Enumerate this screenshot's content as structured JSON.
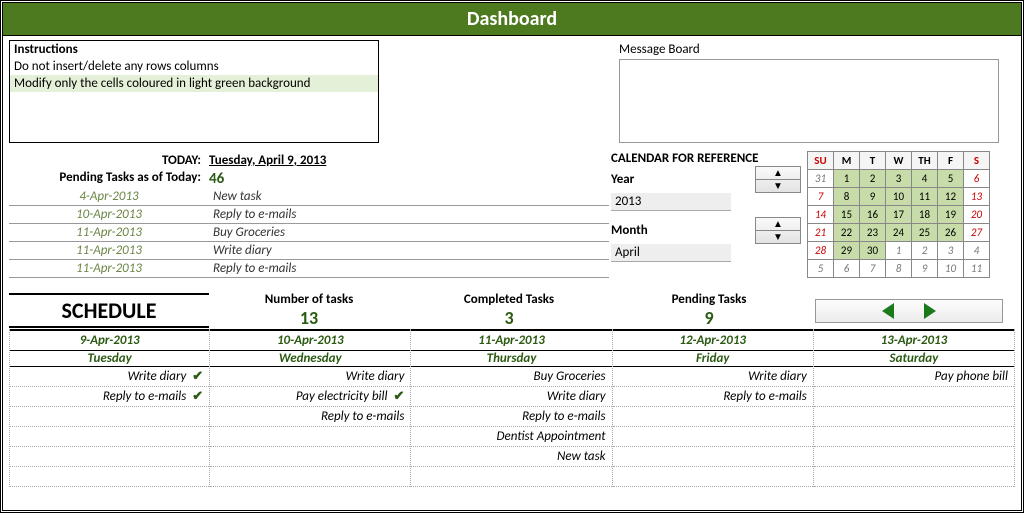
{
  "title": "Dashboard",
  "instructions": {
    "heading": "Instructions",
    "line1": "Do not insert/delete any rows columns",
    "line2": "Modify only the cells coloured in light green background"
  },
  "message_board_label": "Message Board",
  "today_label": "TODAY:",
  "today_value": "Tuesday, April 9, 2013",
  "pending_label": "Pending Tasks as of Today:",
  "pending_count": "46",
  "pending_list": [
    {
      "date": "4-Apr-2013",
      "task": "New task"
    },
    {
      "date": "10-Apr-2013",
      "task": "Reply to e-mails"
    },
    {
      "date": "11-Apr-2013",
      "task": "Buy Groceries"
    },
    {
      "date": "11-Apr-2013",
      "task": "Write diary"
    },
    {
      "date": "11-Apr-2013",
      "task": "Reply to e-mails"
    }
  ],
  "calendar_ref": {
    "title": "CALENDAR FOR REFERENCE",
    "year_label": "Year",
    "year_value": "2013",
    "month_label": "Month",
    "month_value": "April",
    "dow": [
      "SU",
      "M",
      "T",
      "W",
      "TH",
      "F",
      "S"
    ],
    "rows": [
      [
        {
          "n": "31",
          "cls": "other wend"
        },
        {
          "n": "1",
          "cls": "green"
        },
        {
          "n": "2",
          "cls": "green"
        },
        {
          "n": "3",
          "cls": "green"
        },
        {
          "n": "4",
          "cls": "green"
        },
        {
          "n": "5",
          "cls": "green"
        },
        {
          "n": "6",
          "cls": "wend"
        }
      ],
      [
        {
          "n": "7",
          "cls": "wend"
        },
        {
          "n": "8",
          "cls": "green"
        },
        {
          "n": "9",
          "cls": "green"
        },
        {
          "n": "10",
          "cls": "green"
        },
        {
          "n": "11",
          "cls": "green"
        },
        {
          "n": "12",
          "cls": "green"
        },
        {
          "n": "13",
          "cls": "wend"
        }
      ],
      [
        {
          "n": "14",
          "cls": "wend"
        },
        {
          "n": "15",
          "cls": "green"
        },
        {
          "n": "16",
          "cls": "green"
        },
        {
          "n": "17",
          "cls": "green"
        },
        {
          "n": "18",
          "cls": "green"
        },
        {
          "n": "19",
          "cls": "green"
        },
        {
          "n": "20",
          "cls": "wend"
        }
      ],
      [
        {
          "n": "21",
          "cls": "wend"
        },
        {
          "n": "22",
          "cls": "green"
        },
        {
          "n": "23",
          "cls": "green"
        },
        {
          "n": "24",
          "cls": "green"
        },
        {
          "n": "25",
          "cls": "green"
        },
        {
          "n": "26",
          "cls": "green"
        },
        {
          "n": "27",
          "cls": "wend"
        }
      ],
      [
        {
          "n": "28",
          "cls": "wend"
        },
        {
          "n": "29",
          "cls": "green"
        },
        {
          "n": "30",
          "cls": "green"
        },
        {
          "n": "1",
          "cls": "other"
        },
        {
          "n": "2",
          "cls": "other"
        },
        {
          "n": "3",
          "cls": "other"
        },
        {
          "n": "4",
          "cls": "other wend"
        }
      ],
      [
        {
          "n": "5",
          "cls": "other wend"
        },
        {
          "n": "6",
          "cls": "other"
        },
        {
          "n": "7",
          "cls": "other"
        },
        {
          "n": "8",
          "cls": "other"
        },
        {
          "n": "9",
          "cls": "other"
        },
        {
          "n": "10",
          "cls": "other"
        },
        {
          "n": "11",
          "cls": "other wend"
        }
      ]
    ]
  },
  "schedule": {
    "title": "SCHEDULE",
    "metrics": {
      "num_label": "Number of tasks",
      "num_value": "13",
      "comp_label": "Completed Tasks",
      "comp_value": "3",
      "pend_label": "Pending Tasks",
      "pend_value": "9"
    },
    "days": [
      {
        "date": "9-Apr-2013",
        "dow": "Tuesday",
        "tasks": [
          {
            "t": "Write diary",
            "done": true
          },
          {
            "t": "Reply to e-mails",
            "done": true
          },
          {
            "t": ""
          },
          {
            "t": ""
          },
          {
            "t": ""
          },
          {
            "t": ""
          }
        ]
      },
      {
        "date": "10-Apr-2013",
        "dow": "Wednesday",
        "tasks": [
          {
            "t": "Write diary"
          },
          {
            "t": "Pay electricity bill",
            "done": true
          },
          {
            "t": "Reply to e-mails"
          },
          {
            "t": ""
          },
          {
            "t": ""
          },
          {
            "t": ""
          }
        ]
      },
      {
        "date": "11-Apr-2013",
        "dow": "Thursday",
        "tasks": [
          {
            "t": "Buy Groceries"
          },
          {
            "t": "Write diary"
          },
          {
            "t": "Reply to e-mails"
          },
          {
            "t": "Dentist Appointment"
          },
          {
            "t": "New task"
          },
          {
            "t": ""
          }
        ]
      },
      {
        "date": "12-Apr-2013",
        "dow": "Friday",
        "tasks": [
          {
            "t": "Write diary"
          },
          {
            "t": "Reply to e-mails"
          },
          {
            "t": ""
          },
          {
            "t": ""
          },
          {
            "t": ""
          },
          {
            "t": ""
          }
        ]
      },
      {
        "date": "13-Apr-2013",
        "dow": "Saturday",
        "tasks": [
          {
            "t": "Pay phone bill"
          },
          {
            "t": ""
          },
          {
            "t": ""
          },
          {
            "t": ""
          },
          {
            "t": ""
          },
          {
            "t": ""
          }
        ]
      }
    ]
  }
}
